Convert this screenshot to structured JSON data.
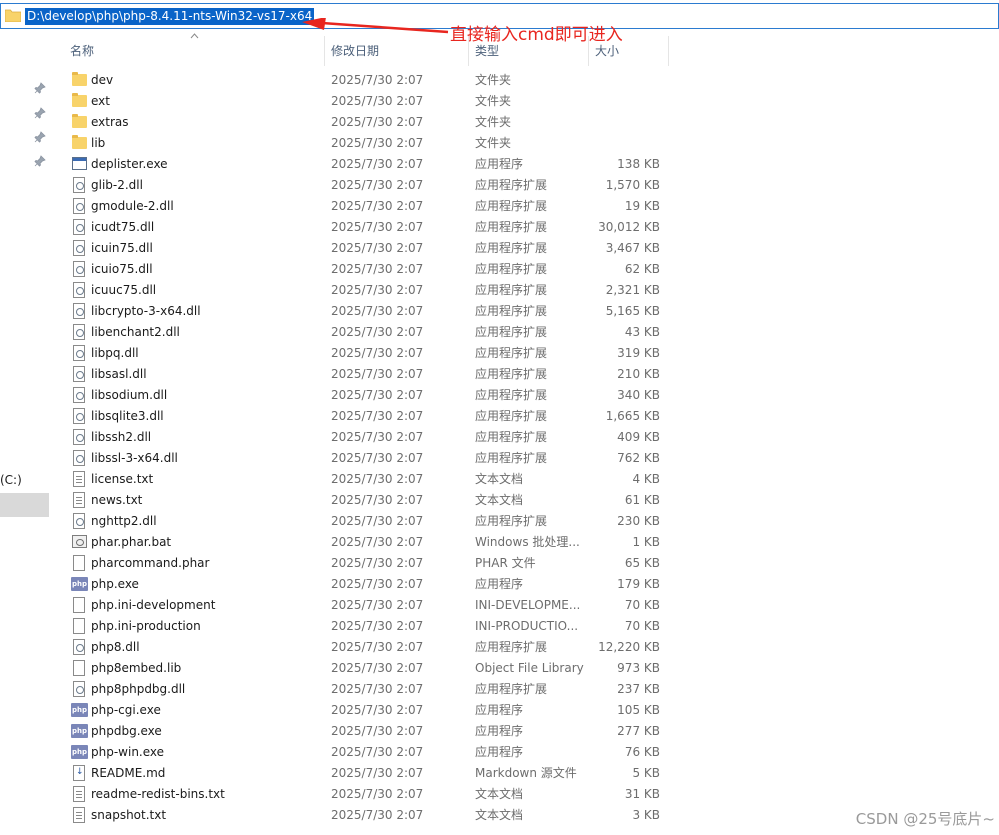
{
  "address": {
    "path": "D:\\develop\\php\\php-8.4.11-nts-Win32-vs17-x64"
  },
  "annotation": {
    "text": "直接输入cmd即可进入",
    "color": "#e8261f"
  },
  "nav": {
    "drive_label": "(C:)"
  },
  "columns": {
    "name": "名称",
    "date": "修改日期",
    "type": "类型",
    "size": "大小"
  },
  "files": [
    {
      "name": "dev",
      "date": "2025/7/30 2:07",
      "type": "文件夹",
      "size": "",
      "icon": "folder-icon"
    },
    {
      "name": "ext",
      "date": "2025/7/30 2:07",
      "type": "文件夹",
      "size": "",
      "icon": "folder-icon"
    },
    {
      "name": "extras",
      "date": "2025/7/30 2:07",
      "type": "文件夹",
      "size": "",
      "icon": "folder-icon"
    },
    {
      "name": "lib",
      "date": "2025/7/30 2:07",
      "type": "文件夹",
      "size": "",
      "icon": "folder-icon"
    },
    {
      "name": "deplister.exe",
      "date": "2025/7/30 2:07",
      "type": "应用程序",
      "size": "138 KB",
      "icon": "exe-icon"
    },
    {
      "name": "glib-2.dll",
      "date": "2025/7/30 2:07",
      "type": "应用程序扩展",
      "size": "1,570 KB",
      "icon": "dll-icon"
    },
    {
      "name": "gmodule-2.dll",
      "date": "2025/7/30 2:07",
      "type": "应用程序扩展",
      "size": "19 KB",
      "icon": "dll-icon"
    },
    {
      "name": "icudt75.dll",
      "date": "2025/7/30 2:07",
      "type": "应用程序扩展",
      "size": "30,012 KB",
      "icon": "dll-icon"
    },
    {
      "name": "icuin75.dll",
      "date": "2025/7/30 2:07",
      "type": "应用程序扩展",
      "size": "3,467 KB",
      "icon": "dll-icon"
    },
    {
      "name": "icuio75.dll",
      "date": "2025/7/30 2:07",
      "type": "应用程序扩展",
      "size": "62 KB",
      "icon": "dll-icon"
    },
    {
      "name": "icuuc75.dll",
      "date": "2025/7/30 2:07",
      "type": "应用程序扩展",
      "size": "2,321 KB",
      "icon": "dll-icon"
    },
    {
      "name": "libcrypto-3-x64.dll",
      "date": "2025/7/30 2:07",
      "type": "应用程序扩展",
      "size": "5,165 KB",
      "icon": "dll-icon"
    },
    {
      "name": "libenchant2.dll",
      "date": "2025/7/30 2:07",
      "type": "应用程序扩展",
      "size": "43 KB",
      "icon": "dll-icon"
    },
    {
      "name": "libpq.dll",
      "date": "2025/7/30 2:07",
      "type": "应用程序扩展",
      "size": "319 KB",
      "icon": "dll-icon"
    },
    {
      "name": "libsasl.dll",
      "date": "2025/7/30 2:07",
      "type": "应用程序扩展",
      "size": "210 KB",
      "icon": "dll-icon"
    },
    {
      "name": "libsodium.dll",
      "date": "2025/7/30 2:07",
      "type": "应用程序扩展",
      "size": "340 KB",
      "icon": "dll-icon"
    },
    {
      "name": "libsqlite3.dll",
      "date": "2025/7/30 2:07",
      "type": "应用程序扩展",
      "size": "1,665 KB",
      "icon": "dll-icon"
    },
    {
      "name": "libssh2.dll",
      "date": "2025/7/30 2:07",
      "type": "应用程序扩展",
      "size": "409 KB",
      "icon": "dll-icon"
    },
    {
      "name": "libssl-3-x64.dll",
      "date": "2025/7/30 2:07",
      "type": "应用程序扩展",
      "size": "762 KB",
      "icon": "dll-icon"
    },
    {
      "name": "license.txt",
      "date": "2025/7/30 2:07",
      "type": "文本文档",
      "size": "4 KB",
      "icon": "txt-icon"
    },
    {
      "name": "news.txt",
      "date": "2025/7/30 2:07",
      "type": "文本文档",
      "size": "61 KB",
      "icon": "txt-icon"
    },
    {
      "name": "nghttp2.dll",
      "date": "2025/7/30 2:07",
      "type": "应用程序扩展",
      "size": "230 KB",
      "icon": "dll-icon"
    },
    {
      "name": "phar.phar.bat",
      "date": "2025/7/30 2:07",
      "type": "Windows 批处理...",
      "size": "1 KB",
      "icon": "bat-icon"
    },
    {
      "name": "pharcommand.phar",
      "date": "2025/7/30 2:07",
      "type": "PHAR 文件",
      "size": "65 KB",
      "icon": "file-icon"
    },
    {
      "name": "php.exe",
      "date": "2025/7/30 2:07",
      "type": "应用程序",
      "size": "179 KB",
      "icon": "php-icon"
    },
    {
      "name": "php.ini-development",
      "date": "2025/7/30 2:07",
      "type": "INI-DEVELOPME...",
      "size": "70 KB",
      "icon": "file-icon"
    },
    {
      "name": "php.ini-production",
      "date": "2025/7/30 2:07",
      "type": "INI-PRODUCTIO...",
      "size": "70 KB",
      "icon": "file-icon"
    },
    {
      "name": "php8.dll",
      "date": "2025/7/30 2:07",
      "type": "应用程序扩展",
      "size": "12,220 KB",
      "icon": "dll-icon"
    },
    {
      "name": "php8embed.lib",
      "date": "2025/7/30 2:07",
      "type": "Object File Library",
      "size": "973 KB",
      "icon": "file-icon"
    },
    {
      "name": "php8phpdbg.dll",
      "date": "2025/7/30 2:07",
      "type": "应用程序扩展",
      "size": "237 KB",
      "icon": "dll-icon"
    },
    {
      "name": "php-cgi.exe",
      "date": "2025/7/30 2:07",
      "type": "应用程序",
      "size": "105 KB",
      "icon": "php-icon"
    },
    {
      "name": "phpdbg.exe",
      "date": "2025/7/30 2:07",
      "type": "应用程序",
      "size": "277 KB",
      "icon": "php-icon"
    },
    {
      "name": "php-win.exe",
      "date": "2025/7/30 2:07",
      "type": "应用程序",
      "size": "76 KB",
      "icon": "php-icon"
    },
    {
      "name": "README.md",
      "date": "2025/7/30 2:07",
      "type": "Markdown 源文件",
      "size": "5 KB",
      "icon": "md-icon"
    },
    {
      "name": "readme-redist-bins.txt",
      "date": "2025/7/30 2:07",
      "type": "文本文档",
      "size": "31 KB",
      "icon": "txt-icon"
    },
    {
      "name": "snapshot.txt",
      "date": "2025/7/30 2:07",
      "type": "文本文档",
      "size": "3 KB",
      "icon": "txt-icon"
    }
  ],
  "watermark": "CSDN @25号底片~"
}
